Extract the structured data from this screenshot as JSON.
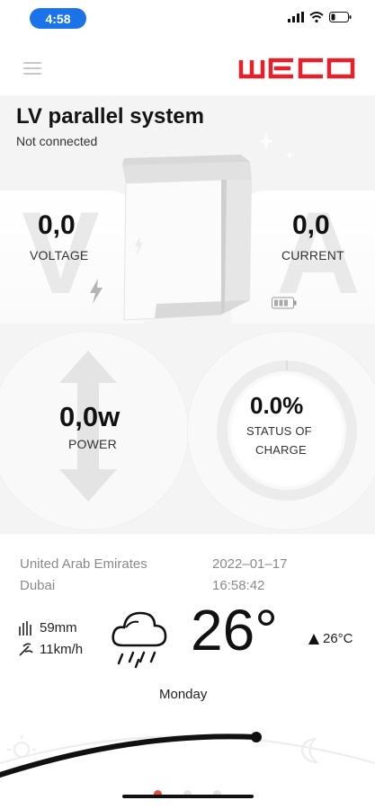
{
  "status_bar": {
    "time": "4:58",
    "icons": [
      "signal-icon",
      "wifi-icon",
      "battery-icon"
    ]
  },
  "header": {
    "brand": "WECO",
    "brand_color": "#e8202a"
  },
  "system": {
    "title": "LV parallel system",
    "connection": "Not connected"
  },
  "metrics": {
    "voltage": {
      "value": "0,0",
      "label": "VOLTAGE",
      "bg_letter": "V"
    },
    "current": {
      "value": "0,0",
      "label": "CURRENT",
      "bg_letter": "A"
    },
    "power": {
      "value": "0,0w",
      "label": "POWER"
    },
    "soc": {
      "value": "0.0%",
      "label_line1": "STATUS OF",
      "label_line2": "CHARGE",
      "level": 0.0
    }
  },
  "weather": {
    "country": "United Arab Emirates",
    "city": "Dubai",
    "date": "2022–01–17",
    "time": "16:58:42",
    "precipitation": "59mm",
    "wind": "11km/h",
    "temperature": "26°",
    "high": "26°C",
    "day": "Monday",
    "condition_icon": "rain-cloud-icon"
  },
  "pager": {
    "pages": 3,
    "active": 0,
    "active_color": "#e8503a"
  }
}
